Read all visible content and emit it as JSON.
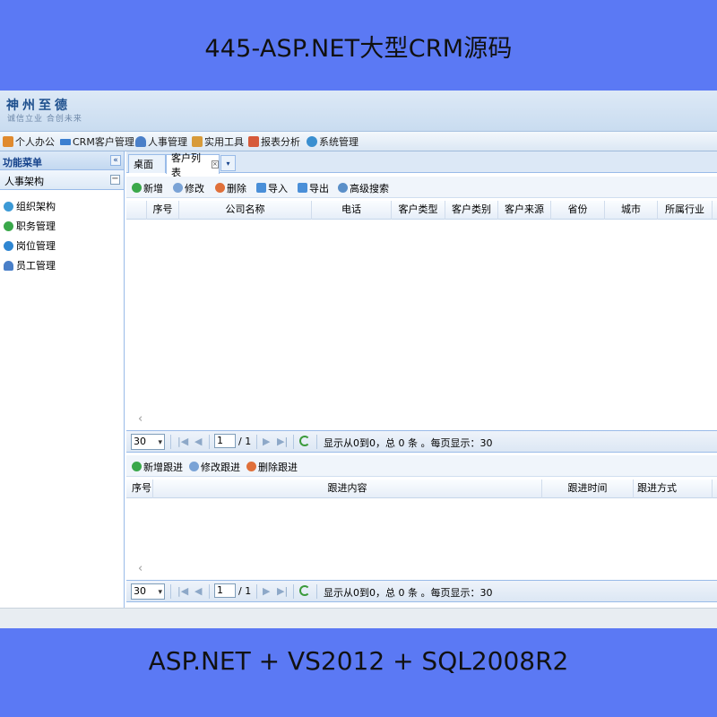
{
  "banner": {
    "title": "445-ASP.NET大型CRM源码",
    "footer": "ASP.NET + VS2012 + SQL2008R2"
  },
  "logo": {
    "main": "神州至德",
    "sub": "诚信立业 合创未来"
  },
  "menu": [
    {
      "label": "个人办公",
      "icon": "home-icon",
      "color": "#e08a2e"
    },
    {
      "label": "CRM客户管理",
      "icon": "card-icon",
      "color": "#3b7fd0"
    },
    {
      "label": "人事管理",
      "icon": "user-icon",
      "color": "#4a7fc8"
    },
    {
      "label": "实用工具",
      "icon": "tools-icon",
      "color": "#d89b3a"
    },
    {
      "label": "报表分析",
      "icon": "chart-icon",
      "color": "#d65a3a"
    },
    {
      "label": "系统管理",
      "icon": "gear-icon",
      "color": "#3a8fd0"
    }
  ],
  "sidebar": {
    "title": "功能菜单",
    "collapse_glyph": "«",
    "section": "人事架构",
    "section_glyph": "−",
    "items": [
      {
        "label": "组织架构",
        "icon": "org-icon",
        "color": "#3d9ad6"
      },
      {
        "label": "职务管理",
        "icon": "job-icon",
        "color": "#3aa84a"
      },
      {
        "label": "岗位管理",
        "icon": "post-icon",
        "color": "#2f86d2"
      },
      {
        "label": "员工管理",
        "icon": "user-icon",
        "color": "#4a7fc8"
      }
    ]
  },
  "tabs": [
    {
      "label": "桌面"
    },
    {
      "label": "客户列表",
      "close": "×"
    }
  ],
  "tabs_more": "▾",
  "customer_toolbar": [
    {
      "label": "新增",
      "icon": "add-icon",
      "color": "#3aa84a"
    },
    {
      "label": "修改",
      "icon": "edit-icon",
      "color": "#7aa3d6"
    },
    {
      "label": "删除",
      "icon": "delete-icon",
      "color": "#e0703a"
    },
    {
      "label": "导入",
      "icon": "import-icon",
      "color": "#4a8fd8"
    },
    {
      "label": "导出",
      "icon": "export-icon",
      "color": "#4a8fd8"
    },
    {
      "label": "高级搜索",
      "icon": "search-icon",
      "color": "#5a8fc8"
    }
  ],
  "customer_grid": {
    "columns": [
      "序号",
      "公司名称",
      "电话",
      "客户类型",
      "客户类别",
      "客户来源",
      "省份",
      "城市",
      "所属行业"
    ]
  },
  "followup_toolbar": [
    {
      "label": "新增跟进",
      "icon": "add-icon",
      "color": "#3aa84a"
    },
    {
      "label": "修改跟进",
      "icon": "edit-icon",
      "color": "#7aa3d6"
    },
    {
      "label": "删除跟进",
      "icon": "delete-icon",
      "color": "#e0703a"
    }
  ],
  "followup_grid": {
    "columns": [
      "序号",
      "跟进内容",
      "跟进时间",
      "跟进方式"
    ]
  },
  "scroll_glyph": "‹",
  "pager": {
    "page_size": "30",
    "select_arrow": "▾",
    "first": "|◀",
    "prev": "◀",
    "page": "1",
    "total": "/ 1",
    "next": "▶",
    "last": "▶|",
    "info": "显示从0到0，总 0 条 。每页显示：30"
  }
}
